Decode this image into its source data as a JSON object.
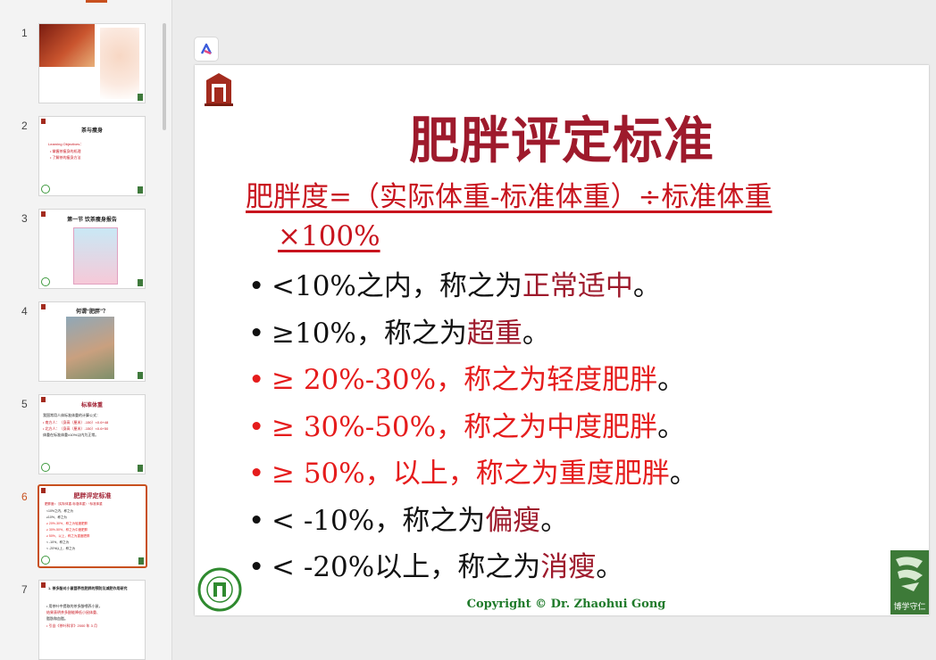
{
  "thumbnails": [
    {
      "num": "1"
    },
    {
      "num": "2",
      "title": "茶与瘦身",
      "lines": [
        "Learning Objectives：",
        "• 掌握茶瘦身的机理",
        "• 了解茶的瘦身方法"
      ]
    },
    {
      "num": "3",
      "title": "第一节  饮茶瘦身报告"
    },
    {
      "num": "4",
      "title": "何谓“肥胖”？"
    },
    {
      "num": "5",
      "title": "标准体重",
      "lines": [
        "我国常用人体标准体重的计算公式：",
        "• 南方人：（身高（厘米）-150）×0.6+48",
        "• 北方人：（身高（厘米）-150）×0.6+50",
        "体重在标准体重±10%以内为正常。"
      ]
    },
    {
      "num": "6",
      "title": "肥胖评定标准"
    },
    {
      "num": "7",
      "title": "1. 茶多酚对小鼠营养性肥胖的预防及减肥作用研究",
      "lines": [
        "• 用茶叶中提取的茶多酚喂养小鼠，",
        "  结果表明茶多酚能降低小鼠体重、",
        "  脂肪和血脂。",
        "• 引自《茶叶科学》2000 年 3 月"
      ]
    }
  ],
  "slide": {
    "title": "肥胖评定标准",
    "formula_line1": "肥胖度=（实际体重-标准体重）÷标准体重",
    "formula_line2": "×100%",
    "bullets": [
      {
        "dot": "•",
        "pre": "<10%之内，称之为",
        "hl": "正常适中",
        "post": "。"
      },
      {
        "dot": "•",
        "pre": "≥10%，称之为",
        "hl": "超重",
        "post": "。"
      },
      {
        "dot": "•",
        "pre": "≥ 20%-30%，称之为轻度肥胖",
        "hl": "",
        "post": "。"
      },
      {
        "dot": "•",
        "pre": "≥ 30%-50%，称之为中度肥胖",
        "hl": "",
        "post": "。"
      },
      {
        "dot": "•",
        "pre": "≥ 50%，以上，称之为重度肥胖",
        "hl": "",
        "post": "。"
      },
      {
        "dot": "•",
        "pre": "< -10%，称之为",
        "hl": "偏瘦",
        "post": "。"
      },
      {
        "dot": "•",
        "pre": "< -20%以上，称之为",
        "hl": "消瘦",
        "post": "。"
      }
    ],
    "copyright": "Copyright © Dr. Zhaohui Gong",
    "corner_logo_caption": "博学守仁"
  },
  "colors": {
    "title": "#9e1a2c",
    "formula": "#c8141e",
    "red_bullet": "#e51c1c",
    "copyright": "#1f7a2a",
    "active_accent": "#c8501e"
  },
  "icons": [
    "ai-assistant-icon",
    "school-logo-icon",
    "university-seal-icon",
    "corner-logo-icon"
  ]
}
